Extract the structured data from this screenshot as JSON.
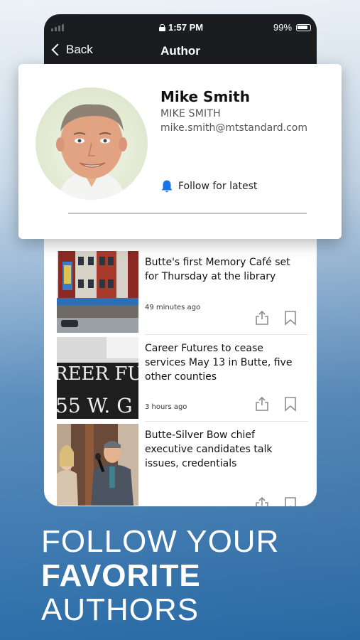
{
  "status_bar": {
    "time": "1:57 PM",
    "battery": "99%"
  },
  "nav": {
    "back_label": "Back",
    "title": "Author"
  },
  "author": {
    "name": "Mike Smith",
    "name_upper": "MIKE SMITH",
    "email": "mike.smith@mtstandard.com",
    "follow_label": "Follow for latest",
    "avatar_icon": "author-photo"
  },
  "articles": [
    {
      "headline": "Butte's first Memory Café set for Thursday at the library",
      "time": "49 minutes ago"
    },
    {
      "headline": "Career Futures to cease services May 13 in Butte, five other counties",
      "time": "3 hours ago",
      "image_sign_text": [
        "REER FU",
        "55 W. G"
      ]
    },
    {
      "headline": "Butte-Silver Bow chief executive candidates talk issues, credentials",
      "time": ""
    }
  ],
  "tagline": {
    "line1": "FOLLOW YOUR",
    "line2": "FAVORITE",
    "line3": "AUTHORS"
  },
  "colors": {
    "accent": "#1a73e8",
    "header_bg": "#1b1c1f",
    "background": "#2f72ad"
  },
  "icons": [
    "back-chevron-icon",
    "lock-icon",
    "battery-icon",
    "bell-icon",
    "share-icon",
    "bookmark-icon"
  ]
}
